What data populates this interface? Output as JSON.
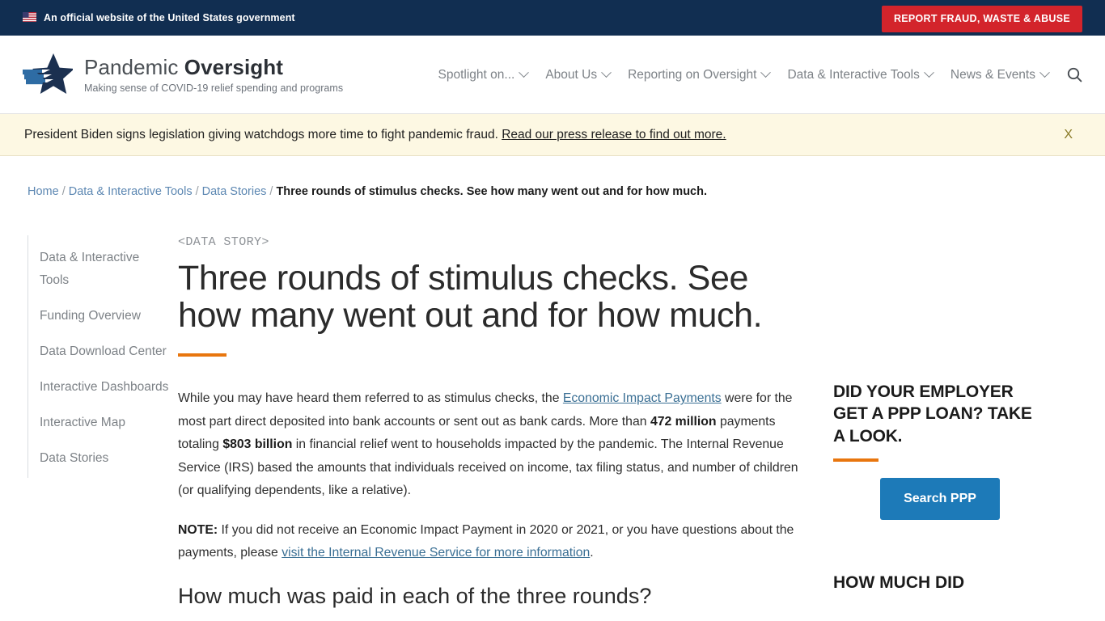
{
  "gov_banner": {
    "flag_icon": "us-flag-icon",
    "text": "An official website of the United States government",
    "report_button": "REPORT FRAUD, WASTE & ABUSE"
  },
  "header": {
    "logo_icon": "pandemic-oversight-star-logo",
    "title_light": "Pandemic ",
    "title_bold": "Oversight",
    "tagline": "Making sense of COVID-19 relief spending and programs",
    "nav": [
      {
        "label": "Spotlight on...",
        "has_caret": true
      },
      {
        "label": "About Us",
        "has_caret": true
      },
      {
        "label": "Reporting on Oversight",
        "has_caret": true
      },
      {
        "label": "Data & Interactive Tools",
        "has_caret": true
      },
      {
        "label": "News & Events",
        "has_caret": true
      }
    ],
    "search_icon": "search-icon"
  },
  "alert": {
    "text": "President Biden signs legislation giving watchdogs more time to fight pandemic fraud. ",
    "link": "Read our press release to find out more.",
    "close_label": "X"
  },
  "breadcrumb": {
    "items": [
      {
        "label": "Home",
        "current": false
      },
      {
        "label": "Data & Interactive Tools",
        "current": false
      },
      {
        "label": "Data Stories",
        "current": false
      },
      {
        "label": "Three rounds of stimulus checks. See how many went out and for how much.",
        "current": true
      }
    ],
    "separator": "/"
  },
  "sidebar": {
    "items": [
      {
        "label": "Data & Interactive Tools"
      },
      {
        "label": "Funding Overview"
      },
      {
        "label": "Data Download Center"
      },
      {
        "label": "Interactive Dashboards"
      },
      {
        "label": "Interactive Map"
      },
      {
        "label": "Data Stories"
      }
    ]
  },
  "main": {
    "eyebrow": "<DATA STORY>",
    "title": "Three rounds of stimulus checks. See how many went out and for how much.",
    "paragraph1": {
      "part1": "While you may have heard them referred to as stimulus checks, the ",
      "link1": "Economic Impact Payments",
      "part2": " were for the most part direct deposited into bank accounts or sent out as bank cards. More than ",
      "bold1": "472 million",
      "part3": " payments totaling ",
      "bold2": "$803 billion",
      "part4": " in financial relief went to households impacted by the pandemic. The Internal Revenue Service (IRS) based the amounts that individuals received on income, tax filing status, and number of children (or qualifying dependents, like a relative)."
    },
    "paragraph2": {
      "label": "NOTE:",
      "part1": " If you did not receive an Economic Impact Payment in 2020 or 2021, or you have questions about the payments, please ",
      "link1": "visit the Internal Revenue Service for more information",
      "part2": "."
    },
    "section_heading": "How much was paid in each of the three rounds?"
  },
  "promo": {
    "title": "DID YOUR EMPLOYER GET A PPP LOAN? TAKE A LOOK.",
    "button": "Search PPP",
    "title2": "HOW MUCH DID"
  },
  "colors": {
    "gov_bar": "#112e51",
    "report_red": "#d3242b",
    "accent_orange": "#e8760e",
    "link_blue": "#3a6f94",
    "button_blue": "#1d7ab8",
    "alert_bg": "#fdf8e3"
  }
}
